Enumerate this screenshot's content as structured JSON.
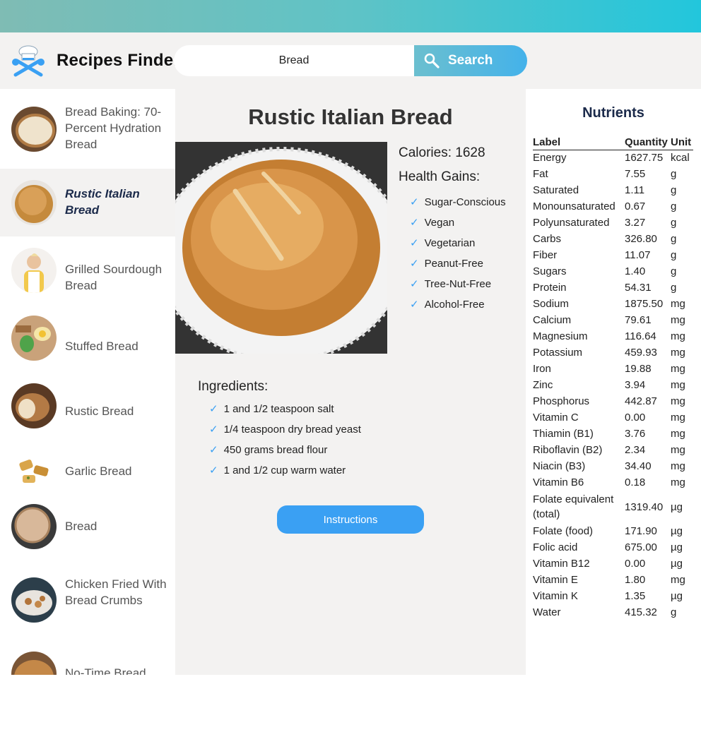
{
  "header": {
    "app_title": "Recipes Finder",
    "search_value": "Bread",
    "search_button": "Search"
  },
  "sidebar": {
    "items": [
      {
        "label": "Bread Baking: 70-Percent Hydration Bread",
        "active": false
      },
      {
        "label": "Rustic Italian Bread",
        "active": true
      },
      {
        "label": "Grilled Sourdough Bread",
        "active": false
      },
      {
        "label": "Stuffed Bread",
        "active": false
      },
      {
        "label": "Rustic Bread",
        "active": false
      },
      {
        "label": "Garlic Bread",
        "active": false
      },
      {
        "label": "Bread",
        "active": false
      },
      {
        "label": "Chicken Fried With Bread Crumbs",
        "active": false
      },
      {
        "label": "No-Time Bread",
        "active": false
      }
    ]
  },
  "recipe": {
    "title": "Rustic Italian Bread",
    "calories": "Calories: 1628",
    "health_title": "Health Gains:",
    "health_gains": [
      "Sugar-Conscious",
      "Vegan",
      "Vegetarian",
      "Peanut-Free",
      "Tree-Nut-Free",
      "Alcohol-Free"
    ],
    "ingredients_title": "Ingredients:",
    "ingredients": [
      "1 and 1/2 teaspoon salt",
      "1/4 teaspoon dry bread yeast",
      "450 grams bread flour",
      "1 and 1/2 cup warm water"
    ],
    "instructions_button": "Instructions"
  },
  "nutrients": {
    "title": "Nutrients",
    "headers": [
      "Label",
      "Quantity",
      "Unit"
    ],
    "rows": [
      [
        "Energy",
        "1627.75",
        "kcal"
      ],
      [
        "Fat",
        "7.55",
        "g"
      ],
      [
        "Saturated",
        "1.11",
        "g"
      ],
      [
        "Monounsaturated",
        "0.67",
        "g"
      ],
      [
        "Polyunsaturated",
        "3.27",
        "g"
      ],
      [
        "Carbs",
        "326.80",
        "g"
      ],
      [
        "Fiber",
        "11.07",
        "g"
      ],
      [
        "Sugars",
        "1.40",
        "g"
      ],
      [
        "Protein",
        "54.31",
        "g"
      ],
      [
        "Sodium",
        "1875.50",
        "mg"
      ],
      [
        "Calcium",
        "79.61",
        "mg"
      ],
      [
        "Magnesium",
        "116.64",
        "mg"
      ],
      [
        "Potassium",
        "459.93",
        "mg"
      ],
      [
        "Iron",
        "19.88",
        "mg"
      ],
      [
        "Zinc",
        "3.94",
        "mg"
      ],
      [
        "Phosphorus",
        "442.87",
        "mg"
      ],
      [
        "Vitamin C",
        "0.00",
        "mg"
      ],
      [
        "Thiamin (B1)",
        "3.76",
        "mg"
      ],
      [
        "Riboflavin (B2)",
        "2.34",
        "mg"
      ],
      [
        "Niacin (B3)",
        "34.40",
        "mg"
      ],
      [
        "Vitamin B6",
        "0.18",
        "mg"
      ],
      [
        "Folate equivalent (total)",
        "1319.40",
        "µg"
      ],
      [
        "Folate (food)",
        "171.90",
        "µg"
      ],
      [
        "Folic acid",
        "675.00",
        "µg"
      ],
      [
        "Vitamin B12",
        "0.00",
        "µg"
      ],
      [
        "Vitamin E",
        "1.80",
        "mg"
      ],
      [
        "Vitamin K",
        "1.35",
        "µg"
      ],
      [
        "Water",
        "415.32",
        "g"
      ]
    ]
  },
  "colors": {
    "accent": "#3aa0f3",
    "active_text": "#1b2a4a",
    "panel_bg": "#f3f2f1"
  }
}
